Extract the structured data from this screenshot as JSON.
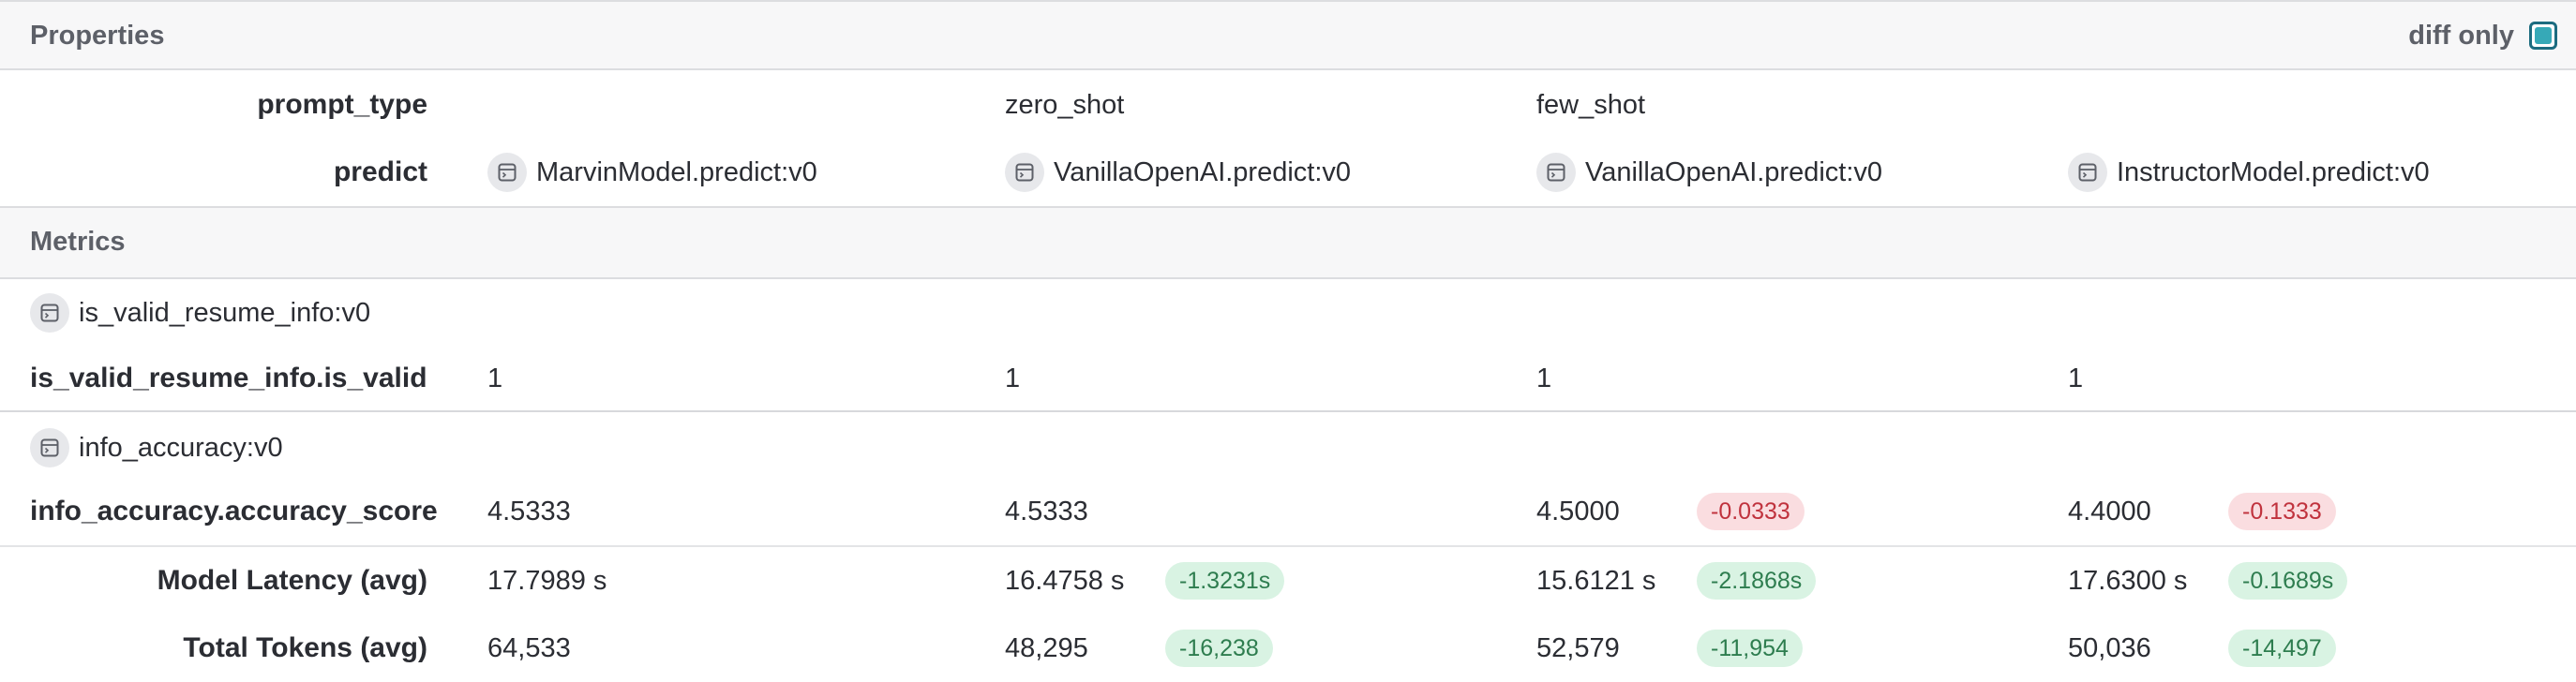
{
  "properties": {
    "title": "Properties",
    "diff_only": {
      "label": "diff only",
      "checked": true
    },
    "rows": [
      {
        "label": "prompt_type",
        "values": [
          "",
          "zero_shot",
          "few_shot",
          ""
        ]
      },
      {
        "label": "predict",
        "values": [
          "MarvinModel.predict:v0",
          "VanillaOpenAI.predict:v0",
          "VanillaOpenAI.predict:v0",
          "InstructorModel.predict:v0"
        ],
        "icon": "op-icon"
      }
    ]
  },
  "metrics": {
    "title": "Metrics",
    "scorers": [
      {
        "name": "is_valid_resume_info:v0",
        "icon": "op-icon",
        "metric": "is_valid_resume_info.is_valid",
        "values": [
          "1",
          "1",
          "1",
          "1"
        ],
        "diffs": [
          "",
          "",
          "",
          ""
        ]
      },
      {
        "name": "info_accuracy:v0",
        "icon": "op-icon",
        "metric": "info_accuracy.accuracy_score",
        "values": [
          "4.5333",
          "4.5333",
          "4.5000",
          "4.4000"
        ],
        "diffs": [
          "",
          "",
          "-0.0333",
          "-0.1333"
        ]
      }
    ],
    "summary": [
      {
        "label": "Model Latency (avg)",
        "values": [
          "17.7989 s",
          "16.4758 s",
          "15.6121 s",
          "17.6300 s"
        ],
        "diffs": [
          "",
          "-1.3231s",
          "-2.1868s",
          "-0.1689s"
        ]
      },
      {
        "label": "Total Tokens (avg)",
        "values": [
          "64,533",
          "48,295",
          "52,579",
          "50,036"
        ],
        "diffs": [
          "",
          "-16,238",
          "-11,954",
          "-14,497"
        ]
      }
    ]
  },
  "colors": {
    "improvement_bg": "#d9f3e3",
    "improvement_text": "#2e7d4f",
    "regression_bg": "#fadde0",
    "regression_text": "#c0323d",
    "checkbox_accent": "#36a9b7"
  }
}
